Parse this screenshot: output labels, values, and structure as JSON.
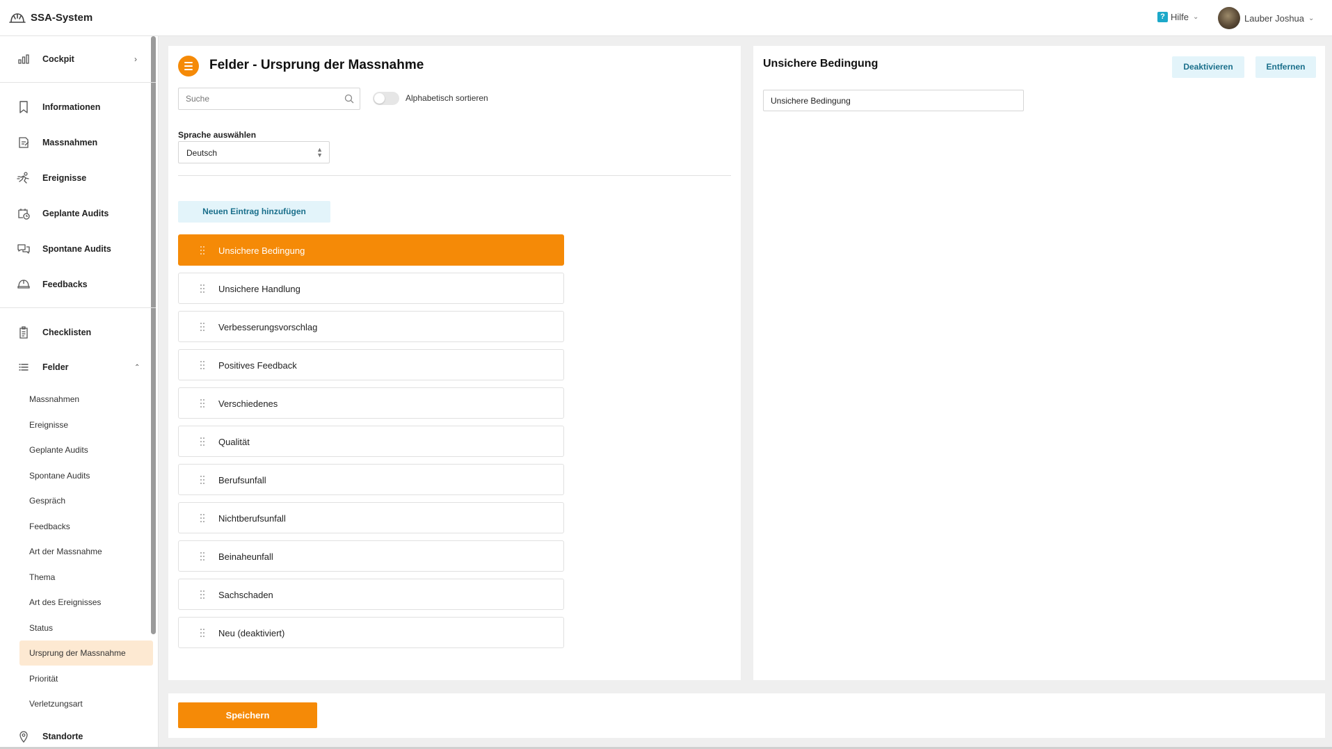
{
  "app": {
    "title": "SSA-System"
  },
  "header": {
    "help_label": "Hilfe",
    "help_icon": "?",
    "user_name": "Lauber Joshua"
  },
  "sidebar": {
    "items": [
      {
        "label": "Cockpit",
        "icon": "bar-chart-icon"
      },
      {
        "label": "Informationen",
        "icon": "bookmark-icon"
      },
      {
        "label": "Massnahmen",
        "icon": "document-pen-icon"
      },
      {
        "label": "Ereignisse",
        "icon": "running-person-icon"
      },
      {
        "label": "Geplante Audits",
        "icon": "calendar-clock-icon"
      },
      {
        "label": "Spontane Audits",
        "icon": "chat-bubbles-icon"
      },
      {
        "label": "Feedbacks",
        "icon": "helmet-icon"
      },
      {
        "label": "Checklisten",
        "icon": "clipboard-icon"
      },
      {
        "label": "Felder",
        "icon": "list-icon"
      },
      {
        "label": "Standorte",
        "icon": "location-pin-icon"
      }
    ],
    "felder_sub": [
      "Massnahmen",
      "Ereignisse",
      "Geplante Audits",
      "Spontane Audits",
      "Gespräch",
      "Feedbacks",
      "Art der Massnahme",
      "Thema",
      "Art des Ereignisses",
      "Status",
      "Ursprung der Massnahme",
      "Priorität",
      "Verletzungsart"
    ],
    "active_sub": "Ursprung der Massnahme"
  },
  "main": {
    "title": "Felder - Ursprung der Massnahme",
    "search_placeholder": "Suche",
    "sort_label": "Alphabetisch sortieren",
    "sort_enabled": false,
    "language_label": "Sprache auswählen",
    "language_value": "Deutsch",
    "add_button": "Neuen Eintrag hinzufügen",
    "entries": [
      "Unsichere Bedingung",
      "Unsichere Handlung",
      "Verbesserungsvorschlag",
      "Positives Feedback",
      "Verschiedenes",
      "Qualität",
      "Berufsunfall",
      "Nichtberufsunfall",
      "Beinaheunfall",
      "Sachschaden",
      "Neu (deaktiviert)"
    ],
    "selected_entry": "Unsichere Bedingung"
  },
  "detail": {
    "title": "Unsichere Bedingung",
    "deactivate_button": "Deaktivieren",
    "remove_button": "Entfernen",
    "name_value": "Unsichere Bedingung"
  },
  "footer": {
    "save_button": "Speichern"
  },
  "colors": {
    "accent": "#f58a07",
    "accent_light": "#fde9d2",
    "info_bg": "#e3f4fa",
    "info_text": "#1a6f8b"
  }
}
